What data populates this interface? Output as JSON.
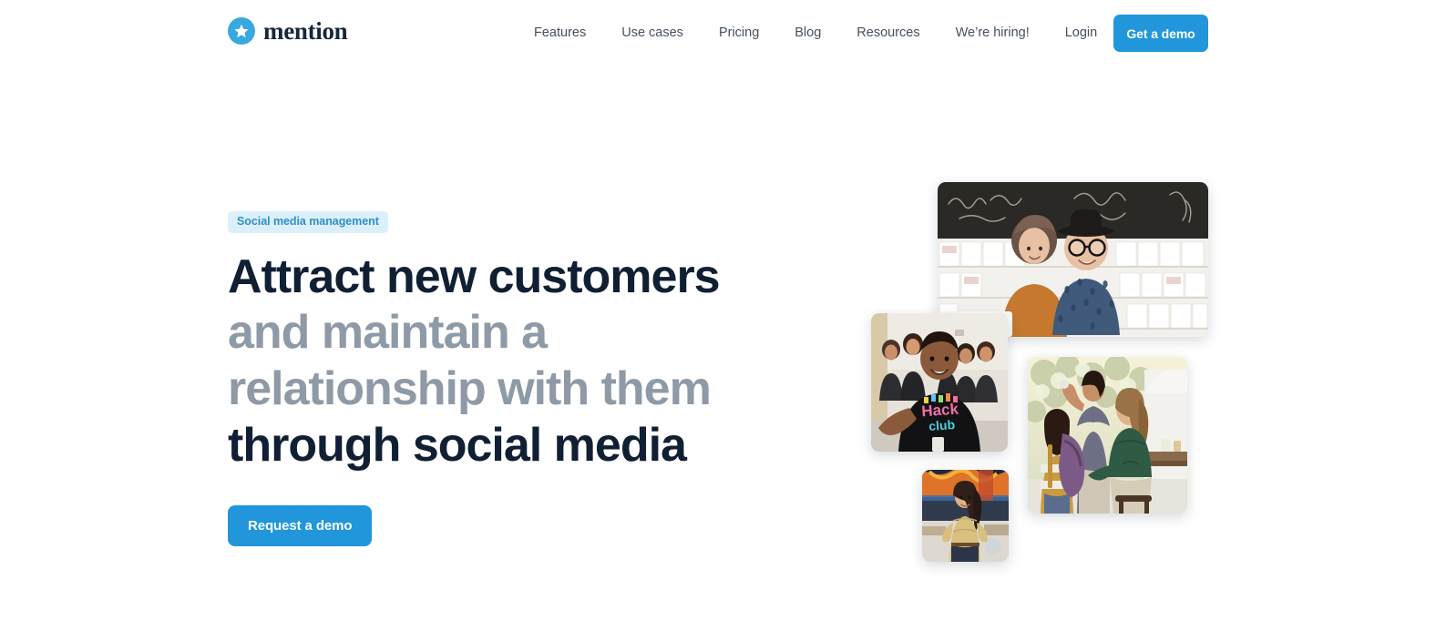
{
  "brand": {
    "name": "mention",
    "logo_icon": "star-in-circle-icon",
    "accent_color": "#2196da",
    "logo_circle_color": "#37a9e0",
    "wordmark_color": "#16263b"
  },
  "nav": {
    "items": [
      {
        "label": "Features",
        "name": "nav-item-features"
      },
      {
        "label": "Use cases",
        "name": "nav-item-use-cases"
      },
      {
        "label": "Pricing",
        "name": "nav-item-pricing"
      },
      {
        "label": "Blog",
        "name": "nav-item-blog"
      },
      {
        "label": "Resources",
        "name": "nav-item-resources"
      },
      {
        "label": "We’re hiring!",
        "name": "nav-item-were-hiring"
      },
      {
        "label": "Login",
        "name": "nav-item-login"
      }
    ],
    "cta_label": "Get a demo"
  },
  "hero": {
    "eyebrow": "Social media management",
    "headline": {
      "line1": "Attract new customers",
      "line2": "and maintain a",
      "line3": "relationship with them",
      "line4": "through social media",
      "dark_color": "#101f33",
      "muted_color": "#8e9aa6"
    },
    "cta_label": "Request a demo",
    "images": [
      {
        "name": "photo-stationery-shop",
        "alt": "Two people smiling in a stationery shop with a chalkboard sign reading Designed & Printed Right Here"
      },
      {
        "name": "photo-hack-club-student",
        "alt": "Smiling young man in a black Hack t-shirt with students behind him"
      },
      {
        "name": "photo-family-outdoors",
        "alt": "Woman in green top seated outdoors with a child wearing a backpack and a man"
      },
      {
        "name": "photo-woman-mural",
        "alt": "Woman in a tan sweater and jeans standing in front of a colorful mural"
      }
    ]
  }
}
